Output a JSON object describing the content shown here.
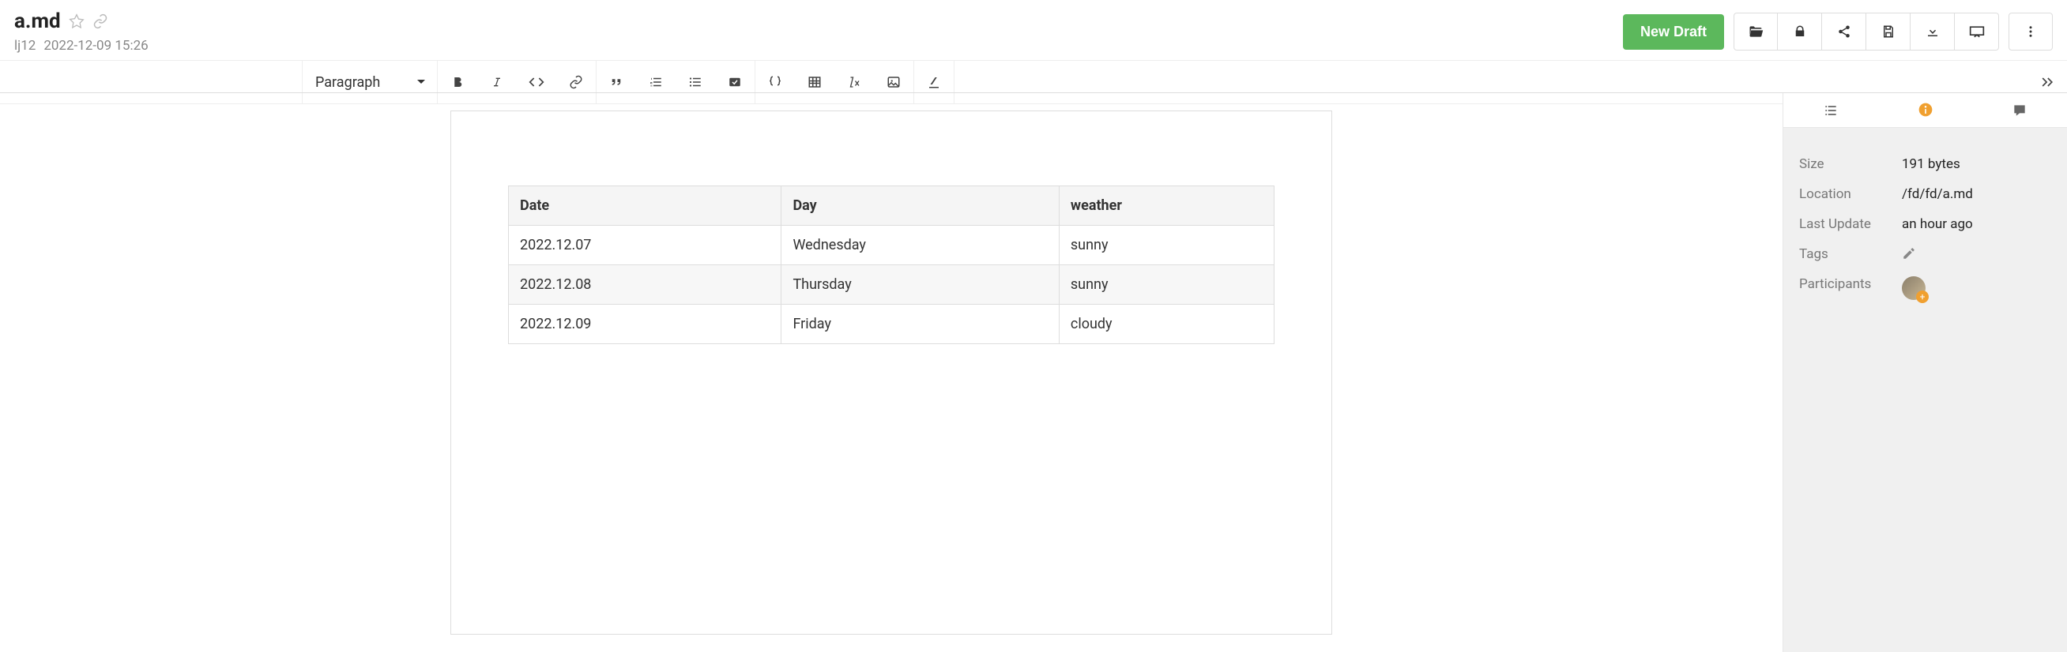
{
  "header": {
    "title": "a.md",
    "author": "lj12",
    "timestamp": "2022-12-09 15:26",
    "new_draft_label": "New Draft"
  },
  "toolbar": {
    "paragraph_label": "Paragraph"
  },
  "table": {
    "headers": [
      "Date",
      "Day",
      "weather"
    ],
    "rows": [
      [
        "2022.12.07",
        "Wednesday",
        "sunny"
      ],
      [
        "2022.12.08",
        "Thursday",
        "sunny"
      ],
      [
        "2022.12.09",
        "Friday",
        "cloudy"
      ]
    ]
  },
  "sidebar": {
    "size_label": "Size",
    "size_value": "191 bytes",
    "location_label": "Location",
    "location_value": "/fd/fd/a.md",
    "last_update_label": "Last Update",
    "last_update_value": "an hour ago",
    "tags_label": "Tags",
    "participants_label": "Participants"
  }
}
